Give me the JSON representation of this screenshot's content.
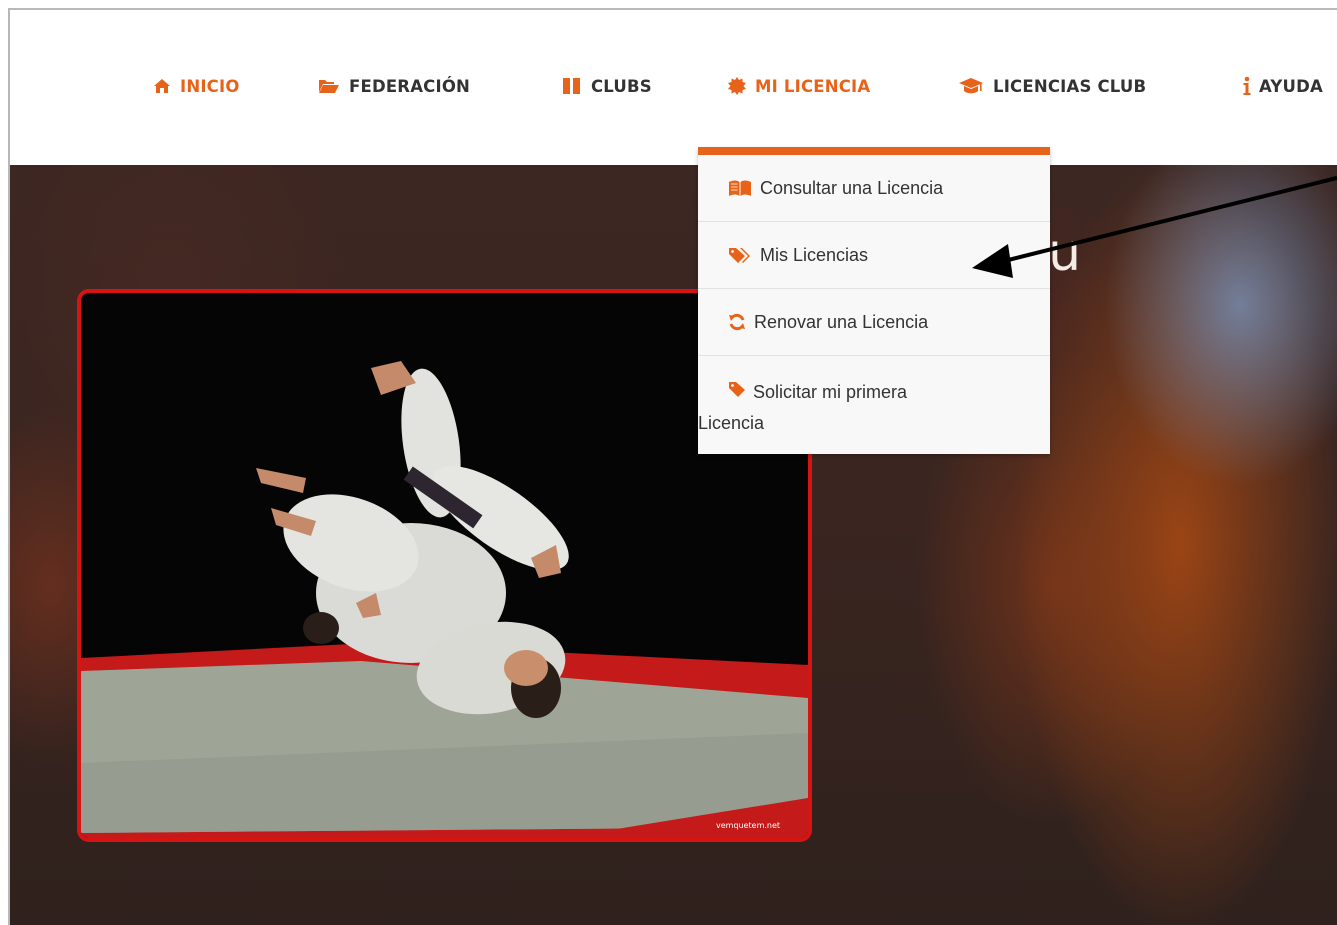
{
  "nav": {
    "items": [
      {
        "label": "INICIO",
        "icon": "home-icon"
      },
      {
        "label": "FEDERACIÓN",
        "icon": "folder-open-icon"
      },
      {
        "label": "CLUBS",
        "icon": "bars-icon"
      },
      {
        "label": "MI LICENCIA",
        "icon": "certificate-icon"
      },
      {
        "label": "LICENCIAS CLUB",
        "icon": "graduation-cap-icon"
      },
      {
        "label": "AYUDA",
        "icon": "info-icon"
      }
    ]
  },
  "dropdown": {
    "items": [
      {
        "label": "Consultar una Licencia",
        "icon": "book-open-icon"
      },
      {
        "label": "Mis Licencias",
        "icon": "tags-icon"
      },
      {
        "label": "Renovar una Licencia",
        "icon": "refresh-icon"
      },
      {
        "label_line1": "Solicitar mi primera",
        "label_line2": "Licencia",
        "icon": "tag-icon"
      }
    ]
  },
  "hero": {
    "heading_fragment": "su",
    "photo_watermark": "vemquetem.net"
  },
  "colors": {
    "accent": "#e8631a",
    "photo_border": "#d61414",
    "nav_text": "#333333"
  }
}
